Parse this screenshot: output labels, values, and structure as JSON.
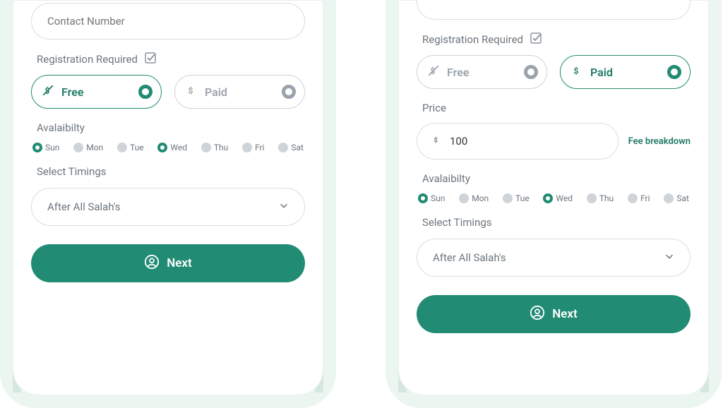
{
  "screenA": {
    "contact_placeholder": "Contact Number",
    "registration_label": "Registration Required",
    "free_label": "Free",
    "paid_label": "Paid",
    "free_selected": true,
    "availability_label": "Avalaibilty",
    "timings_label": "Select Timings",
    "timings_value": "After All Salah's",
    "next_label": "Next"
  },
  "screenB": {
    "registration_label": "Registration Required",
    "free_label": "Free",
    "paid_label": "Paid",
    "paid_selected": true,
    "price_label": "Price",
    "price_value": "100",
    "fee_link": "Fee breakdown",
    "availability_label": "Avalaibilty",
    "timings_label": "Select Timings",
    "timings_value": "After All Salah's",
    "next_label": "Next"
  },
  "days": [
    {
      "abbr": "Sun",
      "on": true
    },
    {
      "abbr": "Mon",
      "on": false
    },
    {
      "abbr": "Tue",
      "on": false
    },
    {
      "abbr": "Wed",
      "on": true
    },
    {
      "abbr": "Thu",
      "on": false
    },
    {
      "abbr": "Fri",
      "on": false
    },
    {
      "abbr": "Sat",
      "on": false
    }
  ],
  "icons": {
    "free": "money-off-icon",
    "paid": "dollar-icon",
    "checkbox": "checkbox-icon",
    "chevron": "chevron-down-icon",
    "next": "user-circle-icon"
  }
}
